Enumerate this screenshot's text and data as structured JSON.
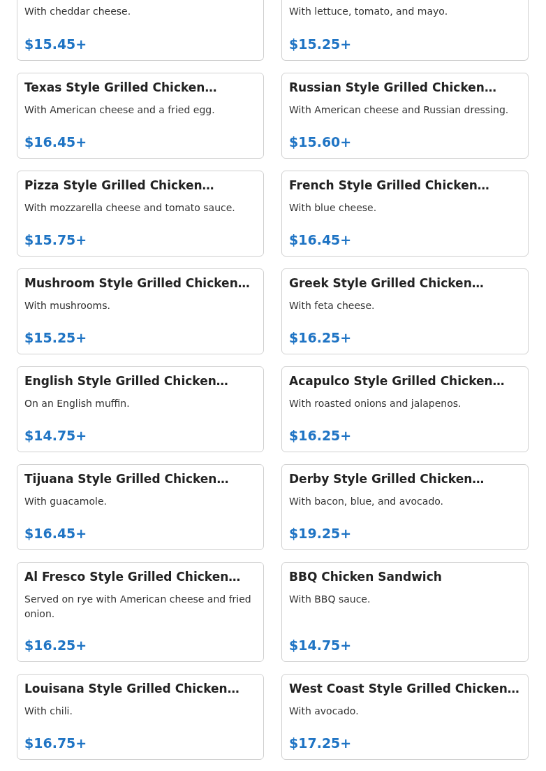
{
  "menu_items": [
    {
      "description": "With cheddar cheese.",
      "price": "$15.45+"
    },
    {
      "description": "With lettuce, tomato, and mayo.",
      "price": "$15.25+"
    },
    {
      "title": "Texas Style Grilled Chicken…",
      "description": "With American cheese and a fried egg.",
      "price": "$16.45+"
    },
    {
      "title": "Russian Style Grilled Chicken…",
      "description": "With American cheese and Russian dressing.",
      "price": "$15.60+"
    },
    {
      "title": "Pizza Style Grilled Chicken…",
      "description": "With mozzarella cheese and tomato sauce.",
      "price": "$15.75+"
    },
    {
      "title": "French Style Grilled Chicken…",
      "description": "With blue cheese.",
      "price": "$16.45+"
    },
    {
      "title": "Mushroom Style Grilled Chicken…",
      "description": "With mushrooms.",
      "price": "$15.25+"
    },
    {
      "title": "Greek Style Grilled Chicken…",
      "description": "With feta cheese.",
      "price": "$16.25+"
    },
    {
      "title": "English Style Grilled Chicken…",
      "description": "On an English muffin.",
      "price": "$14.75+"
    },
    {
      "title": "Acapulco Style Grilled Chicken…",
      "description": "With roasted onions and jalapenos.",
      "price": "$16.25+"
    },
    {
      "title": "Tijuana Style Grilled Chicken…",
      "description": "With guacamole.",
      "price": "$16.45+"
    },
    {
      "title": "Derby Style Grilled Chicken…",
      "description": "With bacon, blue, and avocado.",
      "price": "$19.25+"
    },
    {
      "title": "Al Fresco Style Grilled Chicken…",
      "description": "Served on rye with American cheese and fried onion.",
      "price": "$16.25+"
    },
    {
      "title": "BBQ Chicken Sandwich",
      "description": "With BBQ sauce.",
      "price": "$14.75+"
    },
    {
      "title": "Louisana Style Grilled Chicken…",
      "description": "With chili.",
      "price": "$16.75+"
    },
    {
      "title": "West Coast Style Grilled Chicken…",
      "description": "With avocado.",
      "price": "$17.25+"
    }
  ]
}
